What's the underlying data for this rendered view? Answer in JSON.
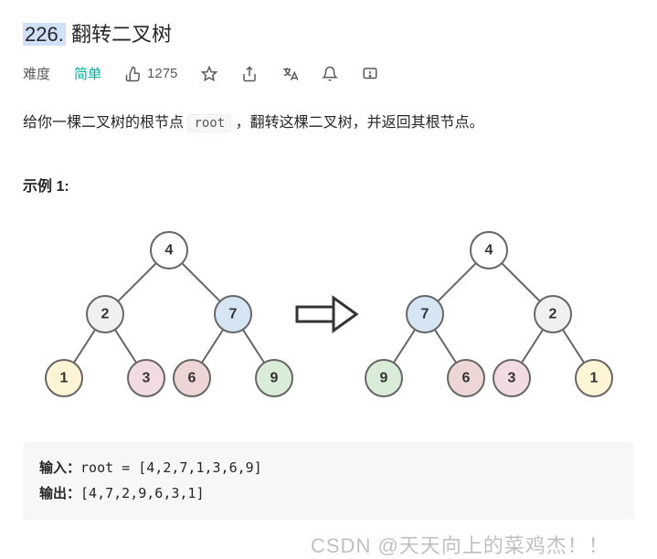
{
  "title": {
    "number": "226.",
    "name": "翻转二叉树"
  },
  "meta": {
    "difficulty_label": "难度",
    "difficulty_value": "简单",
    "likes": "1275"
  },
  "description": {
    "pre": "给你一棵二叉树的根节点 ",
    "code": "root",
    "post": " ，翻转这棵二叉树，并返回其根节点。"
  },
  "example_label": "示例 1:",
  "example": {
    "input_label": "输入：",
    "input_value": "root = [4,2,7,1,3,6,9]",
    "output_label": "输出：",
    "output_value": "[4,7,2,9,6,3,1]"
  },
  "chart_data": {
    "type": "tree-diagram",
    "left_tree": {
      "root": 4,
      "children": [
        {
          "value": 2,
          "children": [
            {
              "value": 1
            },
            {
              "value": 3
            }
          ]
        },
        {
          "value": 7,
          "children": [
            {
              "value": 6
            },
            {
              "value": 9
            }
          ]
        }
      ]
    },
    "right_tree": {
      "root": 4,
      "children": [
        {
          "value": 7,
          "children": [
            {
              "value": 9
            },
            {
              "value": 6
            }
          ]
        },
        {
          "value": 2,
          "children": [
            {
              "value": 3
            },
            {
              "value": 1
            }
          ]
        }
      ]
    },
    "node_colors": {
      "1": "#fff4d6",
      "2": "#f0f0f0",
      "3": "#f3dbe6",
      "4": "#ffffff",
      "6": "#efd6d6",
      "7": "#d6e5f3",
      "9": "#d8ecd8"
    }
  },
  "watermark": "CSDN @天天向上的菜鸡杰！！"
}
